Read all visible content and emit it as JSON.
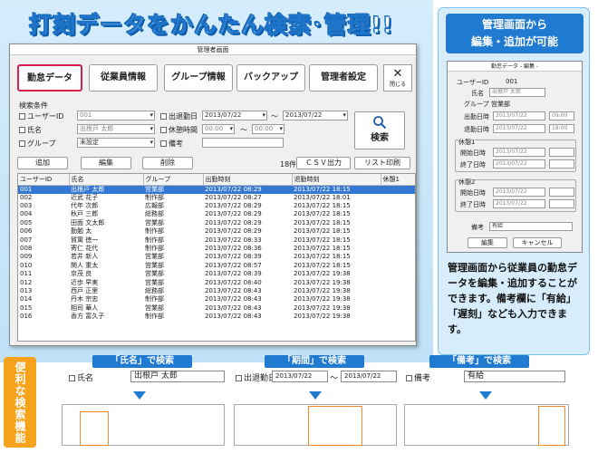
{
  "headline": "打刻データをかんたん検索･管理!!",
  "window": {
    "title": "管理者画面",
    "tabs": [
      "勤怠データ",
      "従業員情報",
      "グループ情報",
      "バックアップ",
      "管理者設定"
    ],
    "close_label": "閉じる",
    "close_glyph": "✕"
  },
  "search": {
    "section_label": "検索条件",
    "user_id_label": "ユーザーID",
    "user_id_value": "001",
    "name_label": "氏名",
    "name_value": "出根戸 太郎",
    "group_label": "グループ",
    "group_value": "未設定",
    "date_label": "出退勤日",
    "date_from": "2013/07/22",
    "date_sep": "～",
    "date_to": "2013/07/22",
    "break_label": "休憩時間",
    "break_from": "00:00",
    "break_to": "00:00",
    "memo_label": "備考",
    "search_button": "検索"
  },
  "actions": {
    "add": "追加",
    "edit": "編集",
    "delete": "削除",
    "count": "18件",
    "csv": "ＣＳＶ出力",
    "print": "リスト印刷"
  },
  "table": {
    "headers": [
      "ユーザーID",
      "氏名",
      "グループ",
      "出勤時刻",
      "退勤時刻",
      "休憩1"
    ],
    "rows": [
      [
        "001",
        "出根戸 太郎",
        "営業部",
        "2013/07/22 08:29",
        "2013/07/22 18:15"
      ],
      [
        "002",
        "近武 花子",
        "制作部",
        "2013/07/22 08:27",
        "2013/07/22 18:01"
      ],
      [
        "003",
        "代年 次郎",
        "広報部",
        "2013/07/22 08:29",
        "2013/07/22 18:15"
      ],
      [
        "004",
        "秋戸 三郎",
        "総務部",
        "2013/07/22 08:29",
        "2013/07/22 18:15"
      ],
      [
        "005",
        "田面 文太郎",
        "営業部",
        "2013/07/22 08:29",
        "2013/07/22 18:15"
      ],
      [
        "006",
        "勤勉 太",
        "制作部",
        "2013/07/22 08:29",
        "2013/07/22 18:15"
      ],
      [
        "007",
        "賀寓 徳一",
        "制作部",
        "2013/07/22 08:33",
        "2013/07/22 18:15"
      ],
      [
        "008",
        "寄仁 花代",
        "制作部",
        "2013/07/22 08:36",
        "2013/07/22 18:15"
      ],
      [
        "009",
        "若井 新人",
        "営業部",
        "2013/07/22 08:39",
        "2013/07/22 18:15"
      ],
      [
        "010",
        "関人 重太",
        "営業部",
        "2013/07/22 08:57",
        "2013/07/22 18:15"
      ],
      [
        "011",
        "京茂 良",
        "営業部",
        "2013/07/22 08:39",
        "2013/07/22 19:38"
      ],
      [
        "012",
        "近歩 早実",
        "営業部",
        "2013/07/22 08:40",
        "2013/07/22 19:38"
      ],
      [
        "013",
        "西戸 正里",
        "総務部",
        "2013/07/22 08:43",
        "2013/07/22 19:38"
      ],
      [
        "014",
        "丹木 宗忠",
        "制作部",
        "2013/07/22 08:43",
        "2013/07/22 19:38"
      ],
      [
        "015",
        "相司 華人",
        "営業部",
        "2013/07/22 08:43",
        "2013/07/22 19:38"
      ],
      [
        "016",
        "香方 富久子",
        "制作部",
        "2013/07/22 08:43",
        "2013/07/22 19:38"
      ]
    ]
  },
  "side": {
    "title_line1": "管理画面から",
    "title_line2": "編集・追加が可能",
    "form_title": "勤怠データ - 編集 -",
    "user_id_label": "ユーザーID",
    "user_id_value": "001",
    "name_label": "氏名",
    "name_value": "出根戸 太郎",
    "group_label": "グループ",
    "group_value": "営業部",
    "in_label": "出勤日時",
    "in_date": "2013/07/22",
    "in_time": "09:00",
    "out_label": "退勤日時",
    "out_date": "2013/07/22",
    "out_time": "18:00",
    "break1_label": "休憩1",
    "break2_label": "休憩2",
    "start_label": "開始日時",
    "end_label": "終了日時",
    "break_date": "2013/07/22",
    "memo_label": "備考",
    "memo_value": "有給",
    "edit_button": "編集",
    "cancel_button": "キャンセル",
    "description": "管理画面から従業員の勤怠データを編集・追加することができます。備考欄に「有給」「遅刻」なども入力できます。"
  },
  "features": {
    "vertical_label": "便利な検索機能",
    "name_search": {
      "title": "「氏名」で検索",
      "label": "氏名",
      "value": "出根戸 太郎"
    },
    "period_search": {
      "title": "「期間」で検索",
      "label": "出退勤日",
      "from": "2013/07/22",
      "sep": "～",
      "to": "2013/07/22"
    },
    "memo_search": {
      "title": "「備考」で検索",
      "label": "備考",
      "value": "有給"
    }
  },
  "colors": {
    "accent": "#1f7ad0",
    "selected_row": "#3478d4",
    "active_tab_border": "#d6204c",
    "feature_label": "#f7a21b"
  }
}
